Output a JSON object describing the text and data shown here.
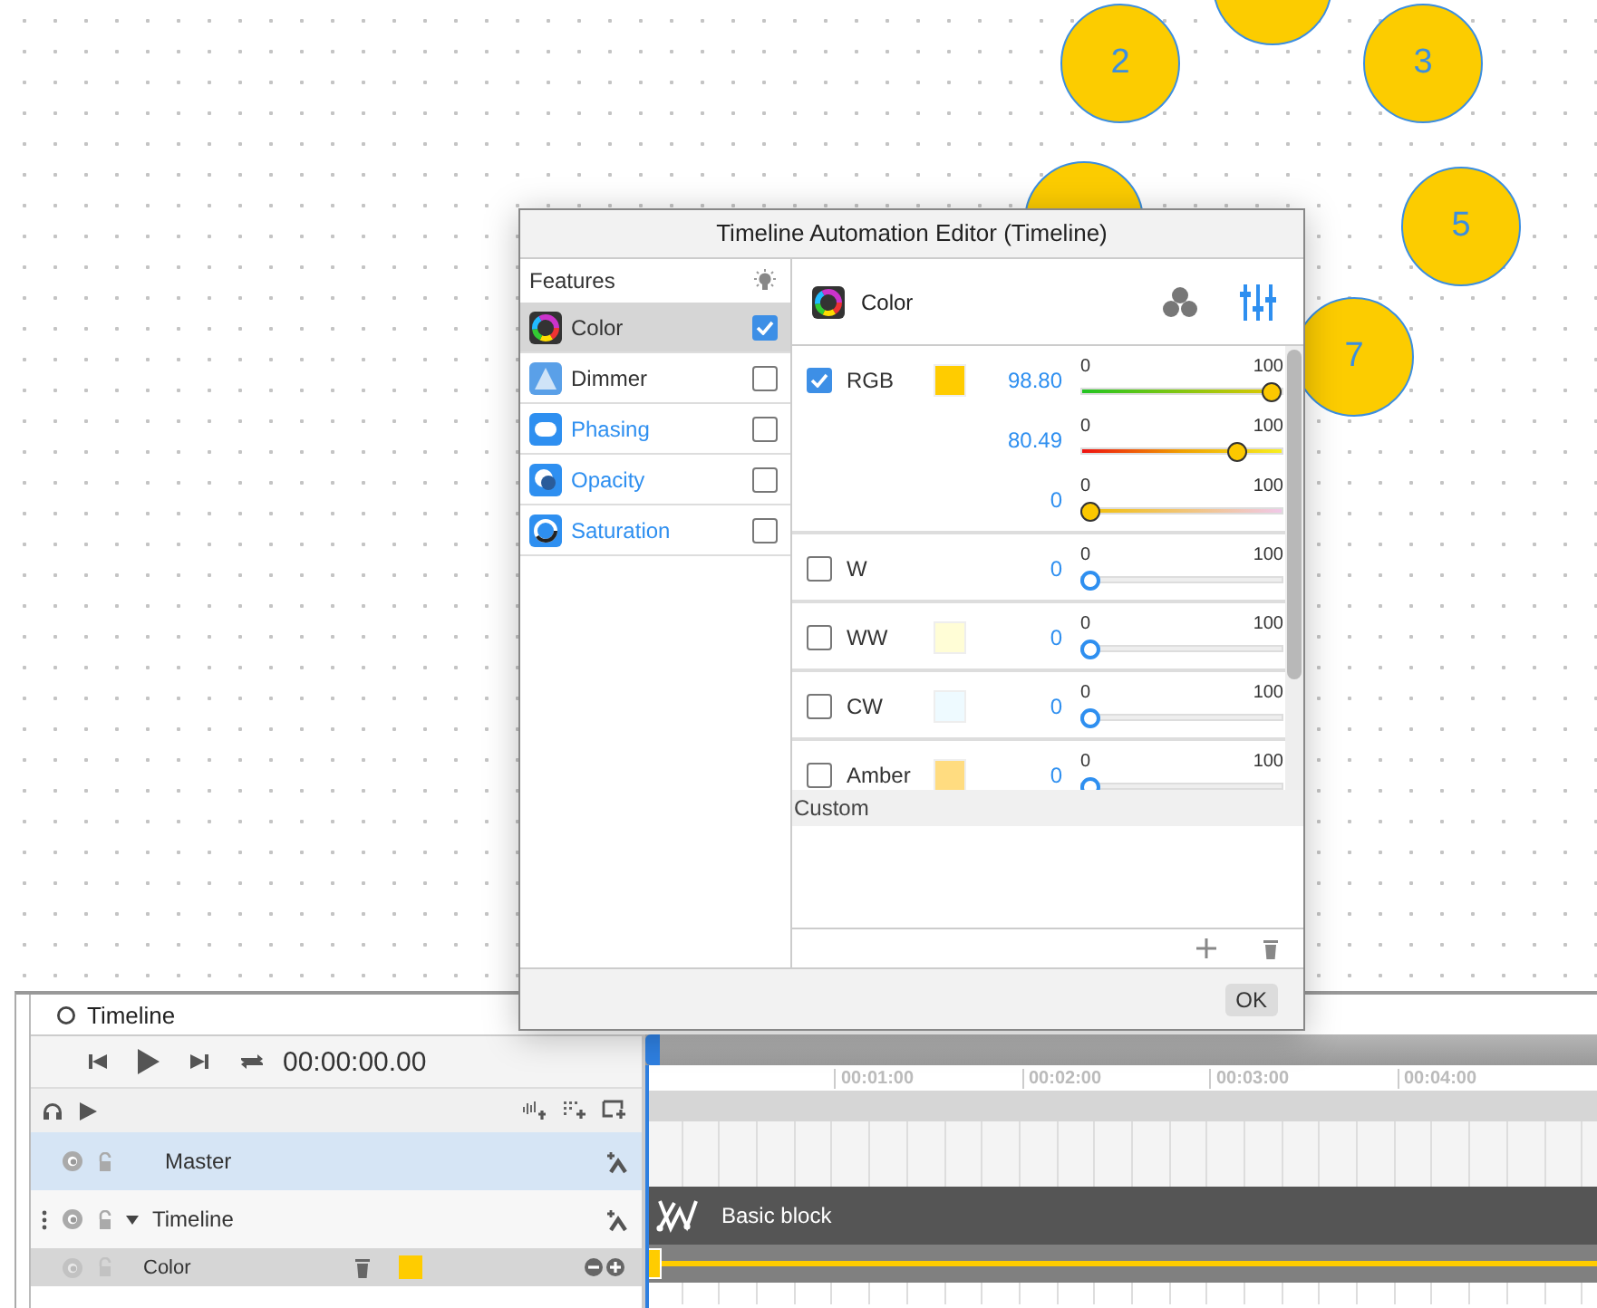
{
  "canvas": {
    "fixtures": [
      {
        "kind": "fixture",
        "label": "2"
      },
      {
        "kind": "fixture"
      },
      {
        "kind": "fixture",
        "label": "3"
      },
      {
        "kind": "fixture"
      },
      {
        "kind": "fixture",
        "label": "5"
      },
      {
        "kind": "fixture",
        "label": "7"
      }
    ]
  },
  "dialog": {
    "title": "Timeline Automation Editor (Timeline)",
    "features_heading": "Features",
    "features": [
      {
        "name": "Color",
        "selected": true,
        "checked": true,
        "emphasized": false
      },
      {
        "name": "Dimmer",
        "selected": false,
        "checked": false,
        "emphasized": false
      },
      {
        "name": "Phasing",
        "selected": false,
        "checked": false,
        "emphasized": true
      },
      {
        "name": "Opacity",
        "selected": false,
        "checked": false,
        "emphasized": true
      },
      {
        "name": "Saturation",
        "selected": false,
        "checked": false,
        "emphasized": true
      }
    ],
    "panel_title": "Color",
    "channels": [
      {
        "name": "RGB",
        "checked": true,
        "color": "#ffcc00",
        "sliders": [
          {
            "reading": "98.80",
            "level": 0.988,
            "min": "0",
            "max": "100"
          },
          {
            "reading": "80.49",
            "level": 0.8049,
            "min": "0",
            "max": "100"
          },
          {
            "reading": "0",
            "level": 0,
            "min": "0",
            "max": "100"
          }
        ]
      },
      {
        "name": "W",
        "checked": false,
        "sliders": [
          {
            "reading": "0",
            "level": 0,
            "min": "0",
            "max": "100"
          }
        ]
      },
      {
        "name": "WW",
        "checked": false,
        "color": "#fffdd6",
        "sliders": [
          {
            "reading": "0",
            "level": 0,
            "min": "0",
            "max": "100"
          }
        ]
      },
      {
        "name": "CW",
        "checked": false,
        "color": "#eefaff",
        "sliders": [
          {
            "reading": "0",
            "level": 0,
            "min": "0",
            "max": "100"
          }
        ]
      },
      {
        "name": "Amber",
        "checked": false,
        "color": "#ffdc80",
        "sliders": [
          {
            "reading": "0",
            "level": 0,
            "min": "0",
            "max": "100"
          }
        ]
      }
    ],
    "custom_heading": "Custom",
    "ok_button": "OK"
  },
  "timeline": {
    "title": "Timeline",
    "time": "00:00:00.00",
    "tracks": [
      {
        "kind": "master",
        "name": "Master",
        "selected": true
      },
      {
        "kind": "group",
        "name": "Timeline",
        "expanded": true,
        "selected": false
      },
      {
        "kind": "automation",
        "name": "Color",
        "color": "#ffcc00",
        "selected": false
      }
    ],
    "ruler": [
      "00:01:00",
      "00:02:00",
      "00:03:00",
      "00:04:00"
    ],
    "block": {
      "name": "Basic block"
    }
  }
}
